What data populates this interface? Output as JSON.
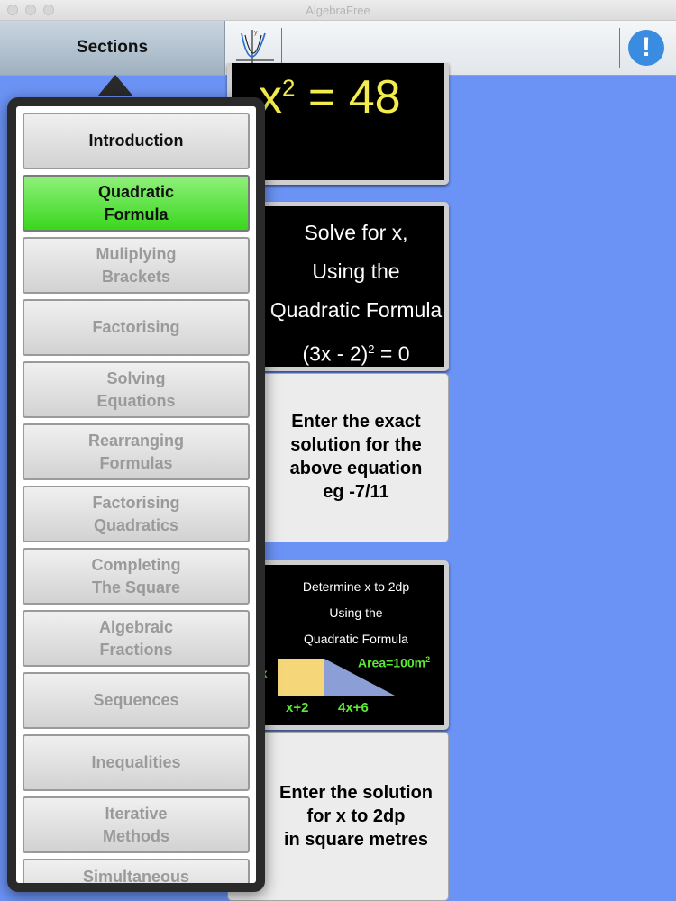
{
  "window": {
    "title": "AlgebraFree"
  },
  "toolbar": {
    "sections_label": "Sections",
    "graph_icon": "graph-icon",
    "info_label": "!"
  },
  "sections": {
    "items": [
      {
        "label": "Introduction",
        "state": "normal"
      },
      {
        "label": "Quadratic\nFormula",
        "state": "selected"
      },
      {
        "label": "Muliplying\nBrackets",
        "state": "disabled"
      },
      {
        "label": "Factorising",
        "state": "disabled"
      },
      {
        "label": "Solving\nEquations",
        "state": "disabled"
      },
      {
        "label": "Rearranging\nFormulas",
        "state": "disabled"
      },
      {
        "label": "Factorising\nQuadratics",
        "state": "disabled"
      },
      {
        "label": "Completing\nThe Square",
        "state": "disabled"
      },
      {
        "label": "Algebraic\nFractions",
        "state": "disabled"
      },
      {
        "label": "Sequences",
        "state": "disabled"
      },
      {
        "label": "Inequalities",
        "state": "disabled"
      },
      {
        "label": "Iterative\nMethods",
        "state": "disabled"
      },
      {
        "label": "Simultaneous",
        "state": "disabled"
      }
    ]
  },
  "cards": {
    "q1": {
      "eq_base": "x",
      "eq_exp": "2",
      "eq_rest": " = 48"
    },
    "q2": {
      "line1": "Solve for x,",
      "line2": "Using the",
      "line3": "Quadratic Formula",
      "eq": "(3x - 2)",
      "eq_exp": "2",
      "eq_tail": " = 0"
    },
    "a2": {
      "text": "Enter the exact\nsolution for the\nabove equation\neg -7/11"
    },
    "q3": {
      "line1": "Determine  x  to 2dp",
      "line2": "Using the",
      "line3": "Quadratic Formula",
      "area": "Area=100m",
      "area_exp": "2",
      "label_left": "x+2",
      "label_right": "4x+6",
      "side": "x"
    },
    "a3": {
      "text": "Enter the solution\nfor x to 2dp\nin square metres"
    }
  },
  "colors": {
    "background": "#6b93f5",
    "selected": "#39d71d",
    "equation": "#f3ec4e",
    "figure_label": "#5ae835",
    "rect": "#f5d77a",
    "triangle": "#8b9fd6"
  }
}
